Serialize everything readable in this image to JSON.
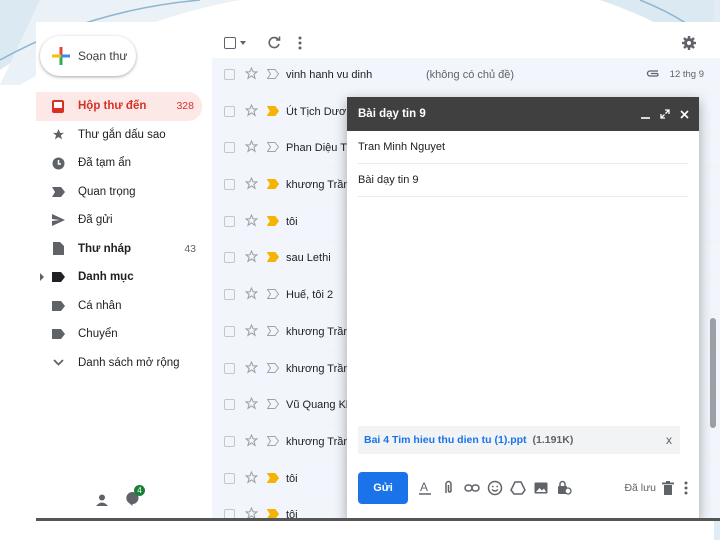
{
  "compose_button": {
    "label": "Soạn thư"
  },
  "sidebar": {
    "items": [
      {
        "label": "Hộp thư đến",
        "count": "328",
        "icon": "inbox-icon"
      },
      {
        "label": "Thư gắn dấu sao",
        "count": "",
        "icon": "star-icon"
      },
      {
        "label": "Đã tạm ẩn",
        "count": "",
        "icon": "clock-icon"
      },
      {
        "label": "Quan trọng",
        "count": "",
        "icon": "important-icon"
      },
      {
        "label": "Đã gửi",
        "count": "",
        "icon": "send-icon"
      },
      {
        "label": "Thư nháp",
        "count": "43",
        "icon": "draft-icon"
      },
      {
        "label": "Danh mục",
        "count": "",
        "icon": "label-icon"
      },
      {
        "label": "Cá nhân",
        "count": "",
        "icon": "label-icon"
      },
      {
        "label": "Chuyển",
        "count": "",
        "icon": "label-icon"
      },
      {
        "label": "Danh sách mở rộng",
        "count": "",
        "icon": "chevron-down-icon"
      }
    ],
    "hangouts_badge": "4"
  },
  "emails": [
    {
      "sender": "vinh hanh vu dinh",
      "subject": "(không có chủ đề)",
      "date": "12 thg 9",
      "important": false
    },
    {
      "sender": "Út Tịch Dương",
      "subject": "",
      "date": "",
      "important": true
    },
    {
      "sender": "Phan Diệu Thư",
      "subject": "",
      "date": "",
      "important": false
    },
    {
      "sender": "khương Trần X",
      "subject": "",
      "date": "",
      "important": true
    },
    {
      "sender": "tôi",
      "subject": "",
      "date": "",
      "important": true
    },
    {
      "sender": "sau Lethi",
      "subject": "",
      "date": "",
      "important": true
    },
    {
      "sender": "Huế, tôi 2",
      "subject": "",
      "date": "",
      "important": false
    },
    {
      "sender": "khương Trần X",
      "subject": "",
      "date": "",
      "important": false
    },
    {
      "sender": "khương Trần X",
      "subject": "",
      "date": "",
      "important": false
    },
    {
      "sender": "Vũ Quang Khi",
      "subject": "",
      "date": "",
      "important": false
    },
    {
      "sender": "khương Trần X",
      "subject": "",
      "date": "",
      "important": false
    },
    {
      "sender": "tôi",
      "subject": "",
      "date": "",
      "important": true
    },
    {
      "sender": "tôi",
      "subject": "",
      "date": "",
      "important": true
    }
  ],
  "compose": {
    "title": "Bài dạy tin 9",
    "to": "Tran Minh Nguyet",
    "subject": "Bài dạy tin 9",
    "attachment_name": "Bai 4 Tim hieu thu dien tu (1).ppt",
    "attachment_size": "(1.191K)",
    "attachment_close": "x",
    "send_label": "Gửi",
    "saved_label": "Đã lưu"
  },
  "colors": {
    "active_bg": "#fce8e6",
    "active_text": "#d93025",
    "send_blue": "#1a73e8",
    "compose_header": "#404040"
  }
}
